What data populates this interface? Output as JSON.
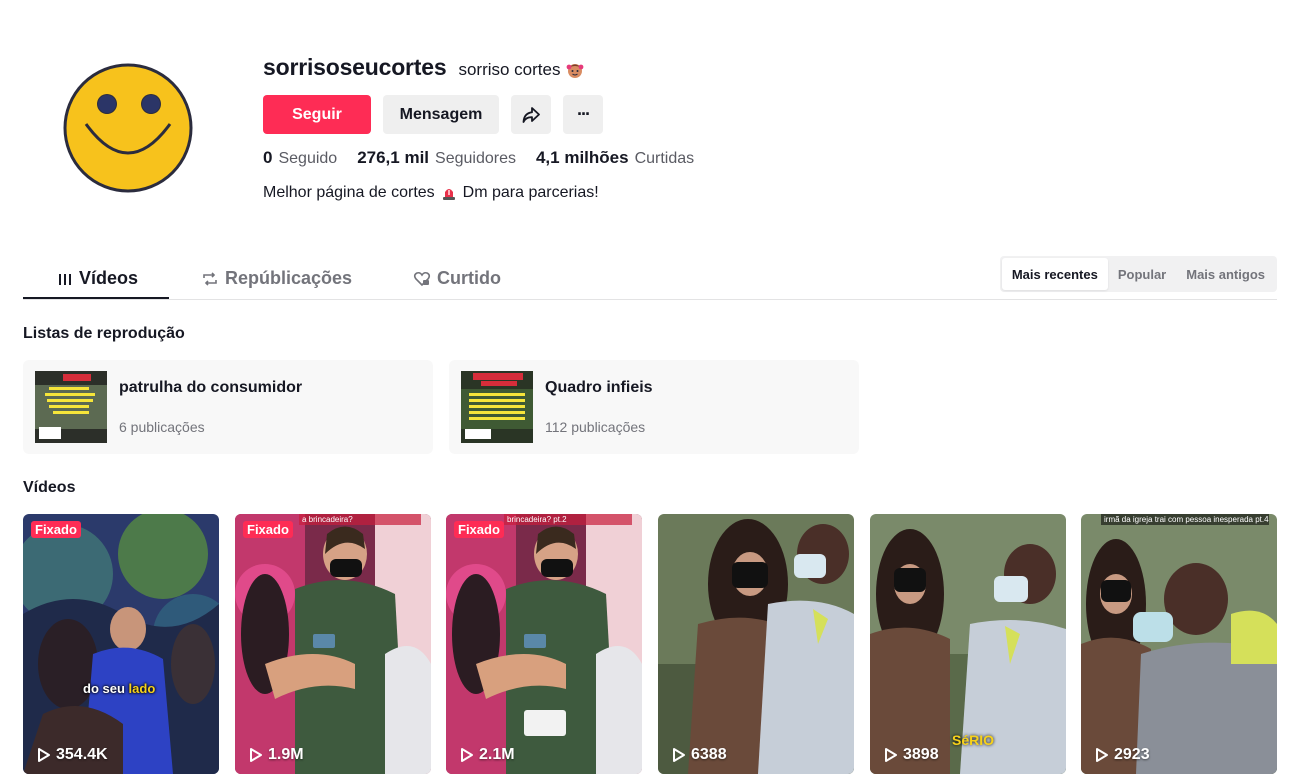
{
  "profile": {
    "username": "sorrisoseucortes",
    "nickname": "sorriso cortes",
    "follow_label": "Seguir",
    "message_label": "Mensagem",
    "more_label": "···",
    "bio": "Melhor página de cortes",
    "bio_suffix": "Dm para parcerias!",
    "stats": [
      {
        "value": "0",
        "label": "Seguido"
      },
      {
        "value": "276,1 mil",
        "label": "Seguidores"
      },
      {
        "value": "4,1 milhões",
        "label": "Curtidas"
      }
    ],
    "avatar_colors": {
      "face": "#f7c21c",
      "outline": "#2b2c3e"
    }
  },
  "tabs": [
    {
      "label": "Vídeos",
      "icon": "grid-bars-icon",
      "active": true
    },
    {
      "label": "Repúblicações",
      "icon": "repost-icon",
      "active": false
    },
    {
      "label": "Curtido",
      "icon": "heart-lock-icon",
      "active": false
    }
  ],
  "sort": [
    {
      "label": "Mais recentes",
      "active": true
    },
    {
      "label": "Popular",
      "active": false
    },
    {
      "label": "Mais antigos",
      "active": false
    }
  ],
  "playlists_title": "Listas de reprodução",
  "playlists": [
    {
      "title": "patrulha do consumidor",
      "count": "6 publicações"
    },
    {
      "title": "Quadro infieis",
      "count": "112 publicações"
    }
  ],
  "videos_title": "Vídeos",
  "videos": [
    {
      "pinned": "Fixado",
      "views": "354.4K",
      "overlay": "do seu",
      "overlay_highlight": "lado"
    },
    {
      "pinned": "Fixado",
      "views": "1.9M",
      "caption": "a brincadeira?"
    },
    {
      "pinned": "Fixado",
      "views": "2.1M",
      "caption": "brincadeira? pt.2"
    },
    {
      "views": "6388"
    },
    {
      "views": "3898",
      "overlay": "SéRIO"
    },
    {
      "views": "2923",
      "caption": "irmã da igreja trai com pessoa inesperada pt.4"
    }
  ],
  "colors": {
    "accent": "#fe2c55",
    "text": "#161823",
    "muted": "#73747b"
  }
}
